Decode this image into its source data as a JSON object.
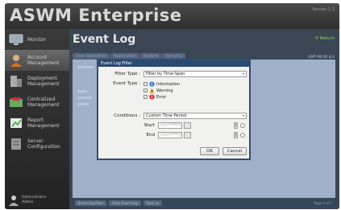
{
  "app": {
    "brand": "ASWM Enterprise",
    "version": "Version 1.2"
  },
  "sidebar": {
    "items": [
      {
        "label": "Monitor",
        "icon": "monitor-icon",
        "active": false
      },
      {
        "label": "Account Management",
        "icon": "account-icon",
        "active": true
      },
      {
        "label": "Deployment Management",
        "icon": "deployment-icon",
        "active": false
      },
      {
        "label": "Centralized Management",
        "icon": "centralized-icon",
        "active": false
      },
      {
        "label": "Report Management",
        "icon": "report-icon",
        "active": false
      },
      {
        "label": "Server Configuration",
        "icon": "server-icon",
        "active": false
      }
    ],
    "user": {
      "role": "Administrator",
      "name": "Admin"
    }
  },
  "main": {
    "title": "Event Log",
    "return_label": "⟲ Return",
    "datetime": "GMT-08:00 8/3",
    "tabs": [
      "User Operation",
      "Application",
      "System",
      "Security"
    ],
    "statusbar": {
      "buttons": [
        "Event Log Filter",
        "Clear Event Log",
        "Save as"
      ],
      "right": "Page 1 of 1"
    }
  },
  "dialog": {
    "title": "Event Log Filter",
    "filter_type_label": "Filter Type :",
    "filter_type_value": "Filter by Time-Span",
    "event_type_label": "Event Type :",
    "event_types": [
      {
        "label": "Information",
        "checked": true,
        "icon": "info-icon"
      },
      {
        "label": "Warning",
        "checked": true,
        "icon": "warning-icon"
      },
      {
        "label": "Error",
        "checked": true,
        "icon": "error-icon"
      }
    ],
    "conditions_label": "Conditions :",
    "conditions_value": "Custom Time Period",
    "start_label": "Start",
    "end_label": "End",
    "date_placeholder": "yyyy/MM/dd",
    "ok_label": "OK",
    "cancel_label": "Cancel"
  },
  "colors": {
    "accent": "#2b4a6f",
    "return": "#9fd15b",
    "content_bg": "#9fb0c8"
  }
}
